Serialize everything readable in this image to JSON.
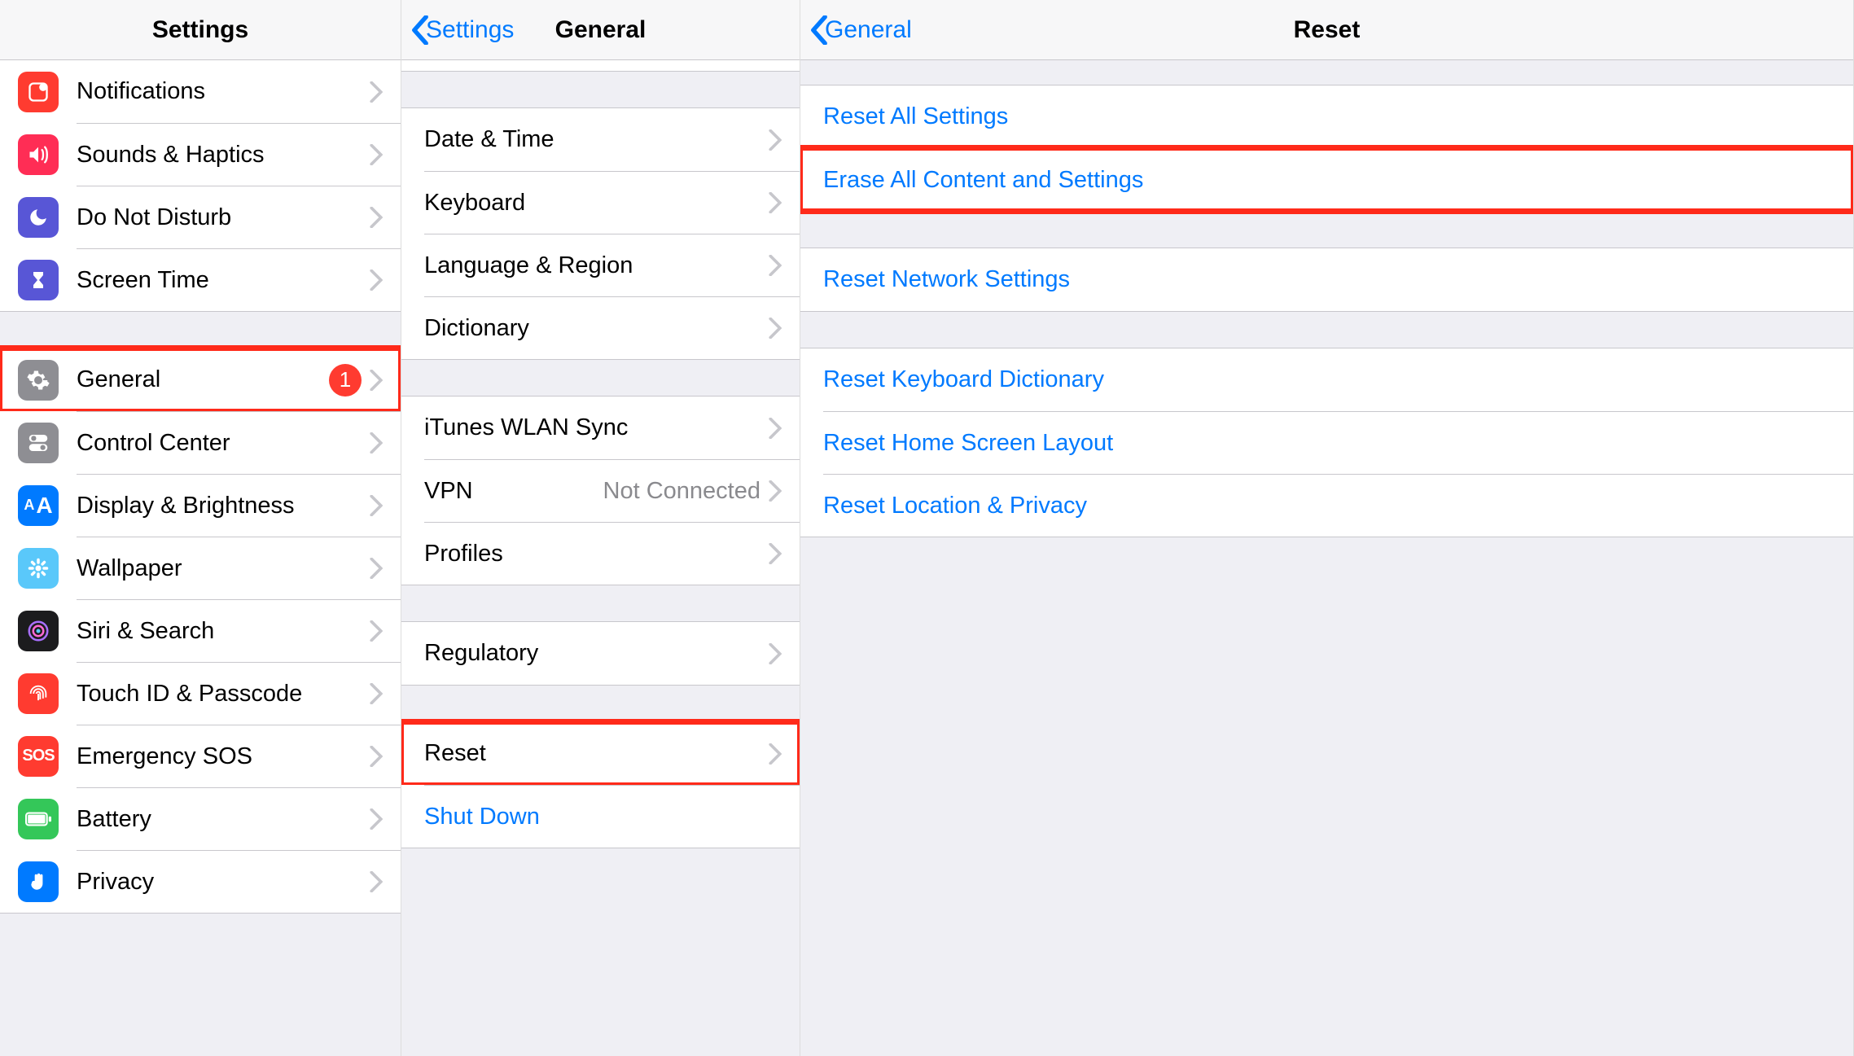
{
  "colors": {
    "accent": "#007aff",
    "badge": "#ff3b30",
    "annotation": "#ff2a1a"
  },
  "pane1": {
    "title": "Settings",
    "groups": [
      {
        "rows": [
          {
            "key": "notifications",
            "label": "Notifications",
            "iconBg": "bg-red"
          },
          {
            "key": "sounds",
            "label": "Sounds & Haptics",
            "iconBg": "bg-pink"
          },
          {
            "key": "dnd",
            "label": "Do Not Disturb",
            "iconBg": "bg-purple"
          },
          {
            "key": "screentime",
            "label": "Screen Time",
            "iconBg": "bg-purple"
          }
        ]
      },
      {
        "rows": [
          {
            "key": "general",
            "label": "General",
            "iconBg": "bg-gray",
            "badge": "1",
            "highlight": true
          },
          {
            "key": "control",
            "label": "Control Center",
            "iconBg": "bg-gray"
          },
          {
            "key": "display",
            "label": "Display & Brightness",
            "iconBg": "bg-blue"
          },
          {
            "key": "wallpaper",
            "label": "Wallpaper",
            "iconBg": "bg-cyan"
          },
          {
            "key": "siri",
            "label": "Siri & Search",
            "iconBg": "bg-black"
          },
          {
            "key": "touchid",
            "label": "Touch ID & Passcode",
            "iconBg": "bg-red"
          },
          {
            "key": "sos",
            "label": "Emergency SOS",
            "iconBg": "bg-red"
          },
          {
            "key": "battery",
            "label": "Battery",
            "iconBg": "bg-green"
          },
          {
            "key": "privacy",
            "label": "Privacy",
            "iconBg": "bg-hand"
          }
        ]
      }
    ]
  },
  "pane2": {
    "back": "Settings",
    "title": "General",
    "groups": [
      {
        "rows": [
          {
            "key": "datetime",
            "label": "Date & Time"
          },
          {
            "key": "keyboard",
            "label": "Keyboard"
          },
          {
            "key": "language",
            "label": "Language & Region"
          },
          {
            "key": "dictionary",
            "label": "Dictionary"
          }
        ]
      },
      {
        "rows": [
          {
            "key": "itunes",
            "label": "iTunes WLAN Sync"
          },
          {
            "key": "vpn",
            "label": "VPN",
            "value": "Not Connected"
          },
          {
            "key": "profiles",
            "label": "Profiles"
          }
        ]
      },
      {
        "rows": [
          {
            "key": "regulatory",
            "label": "Regulatory"
          }
        ]
      },
      {
        "rows": [
          {
            "key": "reset",
            "label": "Reset",
            "highlight": true
          },
          {
            "key": "shutdown",
            "label": "Shut Down",
            "link": true,
            "noChevron": true
          }
        ]
      }
    ]
  },
  "pane3": {
    "back": "General",
    "title": "Reset",
    "groups": [
      {
        "rows": [
          {
            "key": "reset-all",
            "label": "Reset All Settings",
            "link": true
          },
          {
            "key": "erase-all",
            "label": "Erase All Content and Settings",
            "link": true,
            "highlight": true
          }
        ]
      },
      {
        "rows": [
          {
            "key": "reset-network",
            "label": "Reset Network Settings",
            "link": true
          }
        ]
      },
      {
        "rows": [
          {
            "key": "reset-keyboard",
            "label": "Reset Keyboard Dictionary",
            "link": true
          },
          {
            "key": "reset-home",
            "label": "Reset Home Screen Layout",
            "link": true
          },
          {
            "key": "reset-location",
            "label": "Reset Location & Privacy",
            "link": true
          }
        ]
      }
    ]
  }
}
